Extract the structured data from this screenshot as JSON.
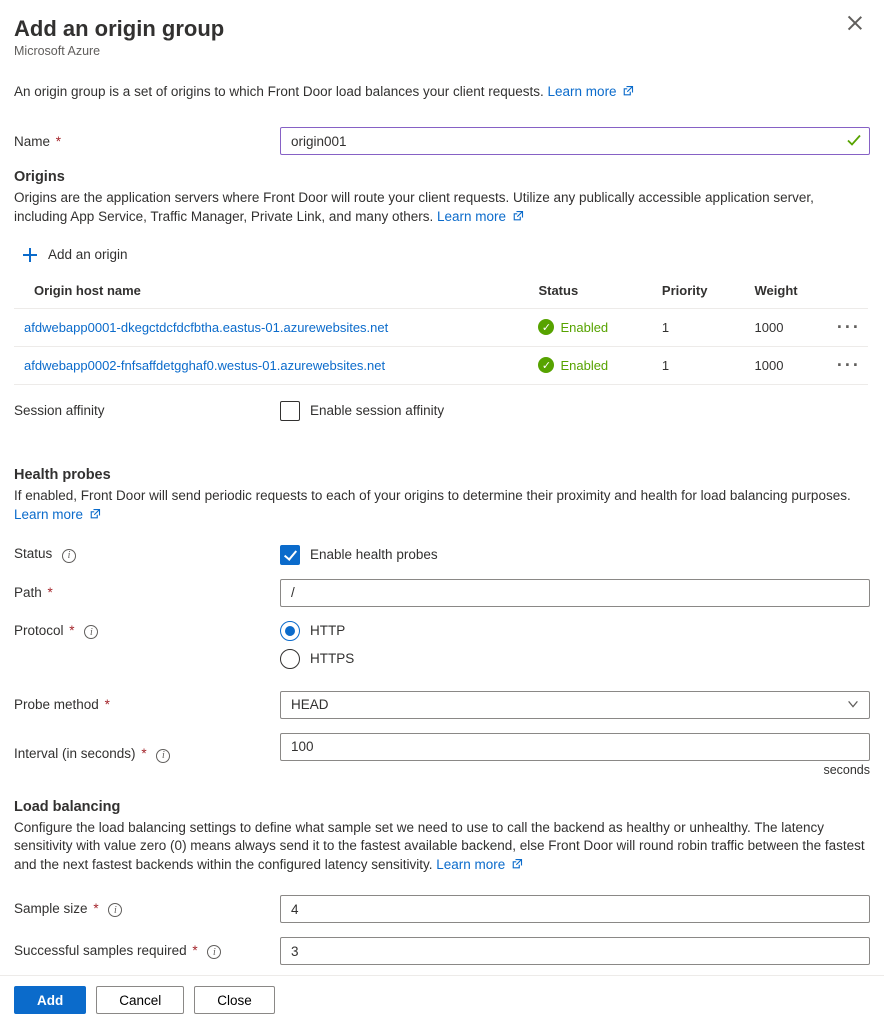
{
  "header": {
    "title": "Add an origin group",
    "subtitle": "Microsoft Azure"
  },
  "intro": {
    "text": "An origin group is a set of origins to which Front Door load balances your client requests. ",
    "learn_more": "Learn more"
  },
  "name_field": {
    "label": "Name",
    "value": "origin001"
  },
  "origins_section": {
    "title": "Origins",
    "desc": "Origins are the application servers where Front Door will route your client requests. Utilize any publically accessible application server, including App Service, Traffic Manager, Private Link, and many others. ",
    "learn_more": "Learn more",
    "add_label": "Add an origin",
    "columns": {
      "c1": "Origin host name",
      "c2": "Status",
      "c3": "Priority",
      "c4": "Weight"
    },
    "rows": [
      {
        "host": "afdwebapp0001-dkegctdcfdcfbtha.eastus-01.azurewebsites.net",
        "status": "Enabled",
        "priority": "1",
        "weight": "1000"
      },
      {
        "host": "afdwebapp0002-fnfsaffdetgghaf0.westus-01.azurewebsites.net",
        "status": "Enabled",
        "priority": "1",
        "weight": "1000"
      }
    ]
  },
  "session_affinity": {
    "label": "Session affinity",
    "checkbox_label": "Enable session affinity"
  },
  "health_probes": {
    "title": "Health probes",
    "desc": "If enabled, Front Door will send periodic requests to each of your origins to determine their proximity and health for load balancing purposes. ",
    "learn_more": "Learn more",
    "status_label": "Status",
    "status_checkbox": "Enable health probes",
    "path_label": "Path",
    "path_value": "/",
    "protocol_label": "Protocol",
    "protocol_options": {
      "http": "HTTP",
      "https": "HTTPS"
    },
    "method_label": "Probe method",
    "method_value": "HEAD",
    "interval_label": "Interval (in seconds)",
    "interval_value": "100",
    "seconds_hint": "seconds"
  },
  "load_balancing": {
    "title": "Load balancing",
    "desc": "Configure the load balancing settings to define what sample set we need to use to call the backend as healthy or unhealthy. The latency sensitivity with value zero (0) means always send it to the fastest available backend, else Front Door will round robin traffic between the fastest and the next fastest backends within the configured latency sensitivity. ",
    "learn_more": "Learn more",
    "sample_label": "Sample size",
    "sample_value": "4",
    "success_label": "Successful samples required",
    "success_value": "3"
  },
  "footer": {
    "add": "Add",
    "cancel": "Cancel",
    "close": "Close"
  }
}
